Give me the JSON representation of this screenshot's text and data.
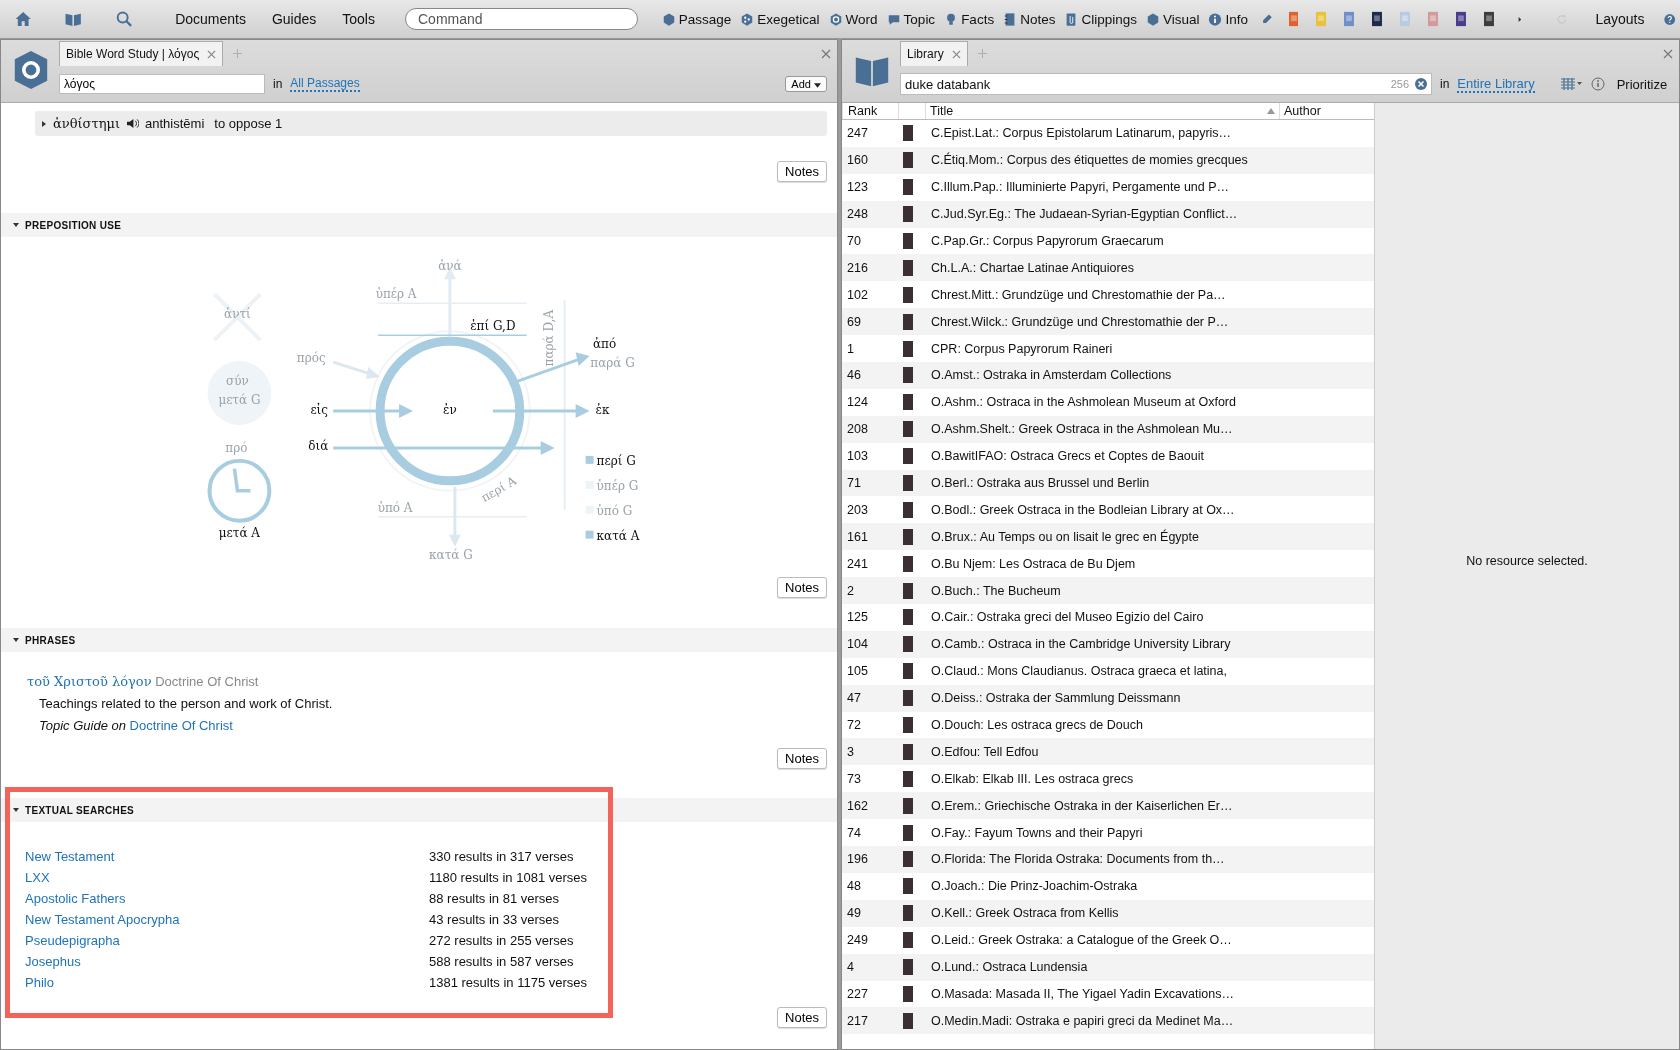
{
  "toolbar": {
    "menus": [
      "Documents",
      "Guides",
      "Tools"
    ],
    "command_placeholder": "Command",
    "tools": [
      {
        "label": "Passage",
        "kind": "hexagon"
      },
      {
        "label": "Exegetical",
        "kind": "dots"
      },
      {
        "label": "Word",
        "kind": "ring"
      },
      {
        "label": "Topic",
        "kind": "bubble"
      },
      {
        "label": "Facts",
        "kind": "bulb"
      },
      {
        "label": "Notes",
        "kind": "notebook"
      },
      {
        "label": "Clippings",
        "kind": "clip"
      },
      {
        "label": "Visual",
        "kind": "hexagon"
      },
      {
        "label": "Info",
        "kind": "info"
      }
    ],
    "layouts": "Layouts"
  },
  "left_panel": {
    "tab": "Bible Word Study | λόγος",
    "search_value": "λόγος",
    "in": "in",
    "scope": "All Passages",
    "add": "Add",
    "entry": {
      "expanded": false,
      "lemma": "ἀνθίστημι",
      "translit": "anthistēmi",
      "gloss": "to oppose 1",
      "notes": "Notes"
    },
    "preposition_use": {
      "title": "PREPOSITION USE",
      "expanded": true,
      "notes": "Notes",
      "labels": [
        {
          "text": "ἀνά",
          "active": false,
          "kind": "label"
        },
        {
          "text": "ὑπέρ A",
          "active": false,
          "kind": "label"
        },
        {
          "text": "ἀντί",
          "active": false,
          "kind": "label"
        },
        {
          "text": "ἐπί G,D",
          "active": true,
          "kind": "label"
        },
        {
          "text": "παρά D,A",
          "active": false,
          "kind": "label"
        },
        {
          "text": "ἀπό",
          "active": true,
          "kind": "label"
        },
        {
          "text": "παρά G",
          "active": false,
          "kind": "label"
        },
        {
          "text": "πρός",
          "active": false,
          "kind": "label"
        },
        {
          "text": "σύν",
          "active": false,
          "kind": "label"
        },
        {
          "text": "μετά G",
          "active": false,
          "kind": "label"
        },
        {
          "text": "εἰς",
          "active": true,
          "kind": "label"
        },
        {
          "text": "ἐν",
          "active": true,
          "kind": "label"
        },
        {
          "text": "ἐκ",
          "active": true,
          "kind": "label"
        },
        {
          "text": "πρό",
          "active": false,
          "kind": "label"
        },
        {
          "text": "διά",
          "active": true,
          "kind": "label"
        },
        {
          "text": "περί G",
          "active": true,
          "kind": "legend"
        },
        {
          "text": "ὑπέρ G",
          "active": false,
          "kind": "legend"
        },
        {
          "text": "ὑπό G",
          "active": false,
          "kind": "legend"
        },
        {
          "text": "κατά A",
          "active": true,
          "kind": "legend"
        },
        {
          "text": "ὑπό A",
          "active": false,
          "kind": "label"
        },
        {
          "text": "περί A",
          "active": false,
          "kind": "label"
        },
        {
          "text": "μετά A",
          "active": true,
          "kind": "label"
        },
        {
          "text": "κατά G",
          "active": false,
          "kind": "label"
        }
      ]
    },
    "phrases": {
      "title": "PHRASES",
      "expanded": true,
      "phrase": "τοῦ Χριστοῦ λόγον",
      "topic": "Doctrine Of Christ",
      "description": "Teachings related to the person and work of Christ.",
      "guide_text": "Topic Guide on",
      "guide_link": "Doctrine Of Christ",
      "notes": "Notes"
    },
    "textual_searches": {
      "title": "TEXTUAL SEARCHES",
      "expanded": true,
      "highlighted": true,
      "notes": "Notes",
      "rows": [
        {
          "corpus": "New Testament",
          "results": "330 results in 317 verses"
        },
        {
          "corpus": "LXX",
          "results": "1180 results in 1081 verses"
        },
        {
          "corpus": "Apostolic Fathers",
          "results": "88 results in 81 verses"
        },
        {
          "corpus": "New Testament Apocrypha",
          "results": "43 results in 33 verses"
        },
        {
          "corpus": "Pseudepigrapha",
          "results": "272 results in 255 verses"
        },
        {
          "corpus": "Josephus",
          "results": "588 results in 587 verses"
        },
        {
          "corpus": "Philo",
          "results": "1381 results in 1175 verses"
        }
      ]
    }
  },
  "right_panel": {
    "tab": "Library",
    "search_value": "duke databank",
    "count": "256",
    "in": "in",
    "scope": "Entire Library",
    "prioritize": "Prioritize",
    "columns": [
      {
        "label": "Rank",
        "sorted": false
      },
      {
        "label": "Title",
        "sorted": true
      },
      {
        "label": "Author",
        "sorted": false
      }
    ],
    "rows": [
      {
        "rank": "247",
        "title": "C.Epist.Lat.: Corpus Epistolarum Latinarum, papyris…"
      },
      {
        "rank": "160",
        "title": "C.Étiq.Mom.: Corpus des étiquettes de momies grecques"
      },
      {
        "rank": "123",
        "title": "C.Illum.Pap.: Illuminierte Papyri, Pergamente und P…"
      },
      {
        "rank": "248",
        "title": "C.Jud.Syr.Eg.: The Judaean-Syrian-Egyptian Conflict…"
      },
      {
        "rank": "70",
        "title": "C.Pap.Gr.: Corpus Papyrorum Graecarum"
      },
      {
        "rank": "216",
        "title": "Ch.L.A.: Chartae Latinae Antiquiores"
      },
      {
        "rank": "102",
        "title": "Chrest.Mitt.: Grundzüge und Chrestomathie der Pa…"
      },
      {
        "rank": "69",
        "title": "Chrest.Wilck.: Grundzüge und Chrestomathie der P…"
      },
      {
        "rank": "1",
        "title": "CPR: Corpus Papyrorum Raineri"
      },
      {
        "rank": "46",
        "title": "O.Amst.: Ostraka in Amsterdam Collections"
      },
      {
        "rank": "124",
        "title": "O.Ashm.: Ostraca in the Ashmolean Museum at Oxford"
      },
      {
        "rank": "208",
        "title": "O.Ashm.Shelt.: Greek Ostraca in the Ashmolean Mu…"
      },
      {
        "rank": "103",
        "title": "O.BawitIFAO: Ostraca Grecs et Coptes de Baouit"
      },
      {
        "rank": "71",
        "title": "O.Berl.: Ostraka aus Brussel und Berlin"
      },
      {
        "rank": "203",
        "title": "O.Bodl.: Greek Ostraca in the Bodleian Library at Ox…"
      },
      {
        "rank": "161",
        "title": "O.Brux.: Au Temps ou on lisait le grec en Égypte"
      },
      {
        "rank": "241",
        "title": "O.Bu Njem: Les Ostraca de Bu Djem"
      },
      {
        "rank": "2",
        "title": "O.Buch.: The Bucheum"
      },
      {
        "rank": "125",
        "title": "O.Cair.: Ostraka greci del Museo Egizio del Cairo"
      },
      {
        "rank": "104",
        "title": "O.Camb.: Ostraca in the Cambridge University Library"
      },
      {
        "rank": "105",
        "title": "O.Claud.: Mons Claudianus. Ostraca graeca et latina,"
      },
      {
        "rank": "47",
        "title": "O.Deiss.: Ostraka der Sammlung Deissmann"
      },
      {
        "rank": "72",
        "title": "O.Douch: Les ostraca grecs de Douch"
      },
      {
        "rank": "3",
        "title": "O.Edfou: Tell Edfou"
      },
      {
        "rank": "73",
        "title": "O.Elkab: Elkab III. Les ostraca grecs"
      },
      {
        "rank": "162",
        "title": "O.Erem.: Griechische Ostraka in der Kaiserlichen Er…"
      },
      {
        "rank": "74",
        "title": "O.Fay.: Fayum Towns and their Papyri"
      },
      {
        "rank": "196",
        "title": "O.Florida: The Florida Ostraka: Documents from th…"
      },
      {
        "rank": "48",
        "title": "O.Joach.: Die Prinz-Joachim-Ostraka"
      },
      {
        "rank": "49",
        "title": "O.Kell.: Greek Ostraca from Kellis"
      },
      {
        "rank": "249",
        "title": "O.Leid.: Greek Ostraka: a Catalogue of the Greek O…"
      },
      {
        "rank": "4",
        "title": "O.Lund.: Ostraca Lundensia"
      },
      {
        "rank": "227",
        "title": "O.Masada: Masada II, The Yigael Yadin Excavations…"
      },
      {
        "rank": "217",
        "title": "O.Medin.Madi: Ostraka e papiri greci da Medinet Ma…"
      }
    ],
    "empty_message": "No resource selected."
  }
}
